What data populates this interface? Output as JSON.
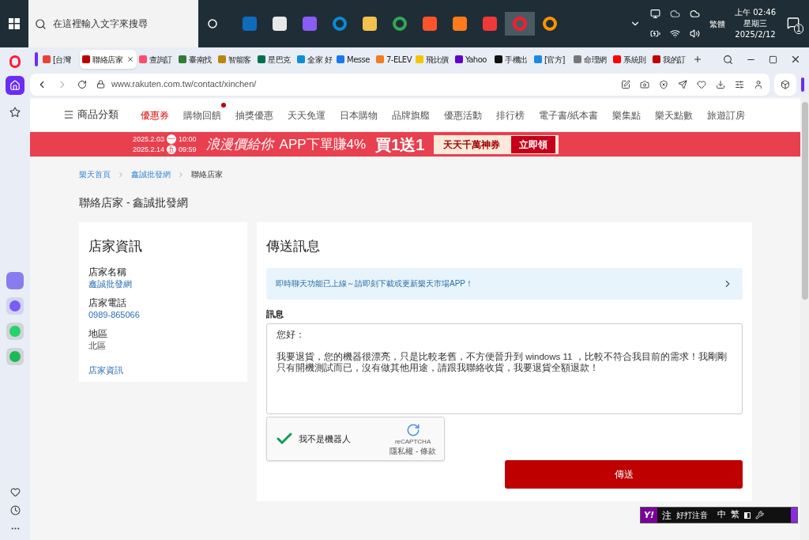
{
  "taskbar": {
    "search_placeholder": "在這裡輸入文字來搜尋",
    "apps": [
      {
        "kind": "mail",
        "selected": false
      },
      {
        "kind": "store",
        "selected": false
      },
      {
        "kind": "copilot",
        "selected": false
      },
      {
        "kind": "edge",
        "selected": false
      },
      {
        "kind": "folder",
        "selected": false
      },
      {
        "kind": "chrome",
        "selected": false
      },
      {
        "kind": "brave",
        "selected": false
      },
      {
        "kind": "orange",
        "selected": false
      },
      {
        "kind": "vivaldi",
        "selected": false
      },
      {
        "kind": "opera",
        "selected": true
      },
      {
        "kind": "firefox",
        "selected": false
      }
    ],
    "input_method": "繁體",
    "time": "上午 02:46",
    "weekday": "星期三",
    "date": "2025/2/12",
    "notifications": "1"
  },
  "sidebar": {
    "items": [
      {
        "kind": "home",
        "selected": true
      },
      {
        "kind": "star",
        "selected": false
      }
    ]
  },
  "tabs": [
    {
      "title": "[台灣",
      "color": "#ea4335",
      "selected": false,
      "closable": false
    },
    {
      "title": "聯絡店家",
      "color": "#bf0000",
      "selected": true,
      "closable": true
    },
    {
      "title": "查詢訂",
      "color": "#ff4d6d",
      "selected": false,
      "closable": false
    },
    {
      "title": "臺南找",
      "color": "#2e7d32",
      "selected": false,
      "closable": false
    },
    {
      "title": "智能客",
      "color": "#b8860b",
      "selected": false,
      "closable": false
    },
    {
      "title": "星巴克",
      "color": "#00704a",
      "selected": false,
      "closable": false
    },
    {
      "title": "全家 好",
      "color": "#0a8fd6",
      "selected": false,
      "closable": false
    },
    {
      "title": "Messe",
      "color": "#1877f2",
      "selected": false,
      "closable": false
    },
    {
      "title": "7-ELEV",
      "color": "#f47b20",
      "selected": false,
      "closable": false
    },
    {
      "title": "飛比價",
      "color": "#f5c400",
      "selected": false,
      "closable": false
    },
    {
      "title": "Yahoo",
      "color": "#6001d2",
      "selected": false,
      "closable": false
    },
    {
      "title": "手機出",
      "color": "#111111",
      "selected": false,
      "closable": false
    },
    {
      "title": "[官方]",
      "color": "#1e88e5",
      "selected": false,
      "closable": false
    },
    {
      "title": "命理網",
      "color": "#777777",
      "selected": false,
      "closable": false
    },
    {
      "title": "系統則",
      "color": "#ff0000",
      "selected": false,
      "closable": false
    },
    {
      "title": "我的訂",
      "color": "#bf0000",
      "selected": false,
      "closable": false
    }
  ],
  "address_bar": {
    "url": "www.rakuten.com.tw/contact/xinchen/"
  },
  "nav": {
    "menu": "商品分類",
    "items": [
      {
        "label": "優惠券",
        "selected": true,
        "badge": false
      },
      {
        "label": "購物回饋",
        "selected": false,
        "badge": true
      },
      {
        "label": "抽獎優惠",
        "selected": false,
        "badge": false
      },
      {
        "label": "天天免運",
        "selected": false,
        "badge": false
      },
      {
        "label": "日本購物",
        "selected": false,
        "badge": false
      },
      {
        "label": "品牌旗艦",
        "selected": false,
        "badge": false
      },
      {
        "label": "優惠活動",
        "selected": false,
        "badge": false
      },
      {
        "label": "排行榜",
        "selected": false,
        "badge": false
      },
      {
        "label": "電子書/紙本書",
        "selected": false,
        "badge": false
      },
      {
        "label": "樂集點",
        "selected": false,
        "badge": false
      },
      {
        "label": "樂天點數",
        "selected": false,
        "badge": false
      },
      {
        "label": "旅遊訂房",
        "selected": false,
        "badge": false
      }
    ]
  },
  "banner": {
    "start_date": "2025.2.03",
    "start_day": "一",
    "start_time": "10:00",
    "end_date": "2025.2.14",
    "end_day": "五",
    "end_time": "09:59",
    "slogan": "浪漫價給你",
    "promo": "APP下單賺4%",
    "deal": "買1送1",
    "coupon": "天天千萬神券",
    "cta": "立即領"
  },
  "breadcrumb": [
    "樂天首頁",
    "鑫誠批發網",
    "聯絡店家"
  ],
  "page_title": "聯絡店家 - 鑫誠批發網",
  "store_info": {
    "title": "店家資訊",
    "fields": [
      {
        "label": "店家名稱",
        "value": "鑫誠批發網",
        "kind": "link"
      },
      {
        "label": "店家電話",
        "value": "0989-865066",
        "kind": "link"
      },
      {
        "label": "地區",
        "value": "北區",
        "kind": "text"
      }
    ],
    "link": "店家資訊"
  },
  "message_form": {
    "title": "傳送訊息",
    "notice": "即時聊天功能已上線～請即刻下載或更新樂天市場APP！",
    "label": "訊息",
    "paragraphs": [
      "您好：",
      "我要退貨，您的機器很漂亮，只是比較老舊，不方便晉升到 windows 11 ，比較不符合我目前的需求！我剛剛只有開機測試而已，沒有做其他用途，請跟我聯絡收貨，我要退貨全額退款！"
    ],
    "captcha": {
      "label": "我不是機器人",
      "checked": true,
      "brand": "reCAPTCHA",
      "links": "隱私權 - 條款"
    },
    "submit": "傳送"
  },
  "ime_bar": {
    "logo": "Y!",
    "mode": "注",
    "name": "好打注音",
    "lang": "中",
    "script": "繁"
  }
}
